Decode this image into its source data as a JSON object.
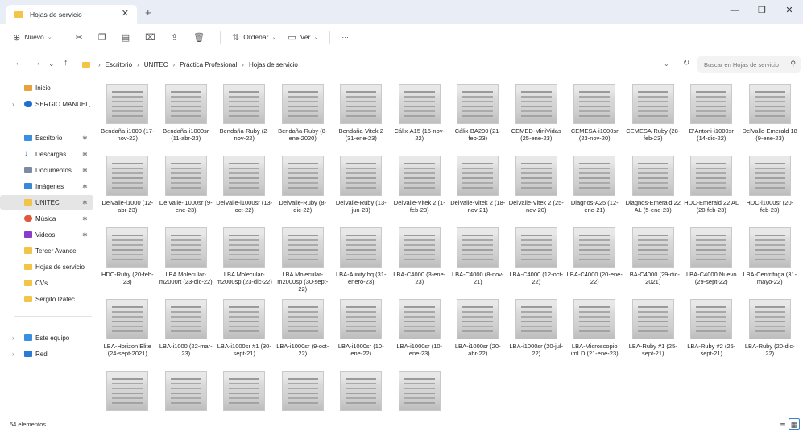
{
  "window": {
    "tab_title": "Hojas de servicio",
    "close_tab": "✕",
    "new_tab": "+",
    "minimize": "—",
    "maximize": "❐",
    "close": "✕"
  },
  "toolbar": {
    "new_label": "Nuevo",
    "sort_label": "Ordenar",
    "view_label": "Ver",
    "more_label": "···"
  },
  "address": {
    "crumbs": [
      "Escritorio",
      "UNITEC",
      "Práctica Profesional",
      "Hojas de servicio"
    ],
    "search_placeholder": "Buscar en Hojas de servicio"
  },
  "sidebar": {
    "items": [
      {
        "label": "Inicio",
        "color": "#e8a33c"
      },
      {
        "label": "SERGIO MANUEL, L",
        "color": "#1f6fd1"
      },
      {
        "label": "Escritorio",
        "color": "#3b8fe0"
      },
      {
        "label": "Descargas",
        "color": "#2a7bd6"
      },
      {
        "label": "Documentos",
        "color": "#7a8ba3"
      },
      {
        "label": "Imágenes",
        "color": "#3a88d8"
      },
      {
        "label": "UNITEC",
        "color": "#f2c44a"
      },
      {
        "label": "Música",
        "color": "#e0573c"
      },
      {
        "label": "Videos",
        "color": "#8a3cc9"
      },
      {
        "label": "Tercer Avance",
        "color": "#f2c44a"
      },
      {
        "label": "Hojas de servicio",
        "color": "#f2c44a"
      },
      {
        "label": "CVs",
        "color": "#f2c44a"
      },
      {
        "label": "Sergito Izatec",
        "color": "#f2c44a"
      },
      {
        "label": "Este equipo",
        "color": "#3b8fe0"
      },
      {
        "label": "Red",
        "color": "#2a7bd6"
      }
    ]
  },
  "files": [
    "Bendaña-i1000 (17-nov-22)",
    "Bendaña-i1000sr (11-abr-23)",
    "Bendaña-Ruby (2-nov-22)",
    "Bendaña-Ruby (8-ene-2020)",
    "Bendaña-Vitek 2 (31-ene-23)",
    "Cálix-A15 (16-nov-22)",
    "Cálix-BA200 (21-feb-23)",
    "CEMED-MiniVidas (25-ene-23)",
    "CEMESA-i1000sr (23-nov-20)",
    "CEMESA-Ruby (28-feb-23)",
    "D'Antoni-i1000sr (14-dic-22)",
    "DelValle-Emerald 18 (9-ene-23)",
    "DelValle-i1000 (12-abr-23)",
    "DelValle-i1000sr (9-ene-23)",
    "DelValle-i1000sr (13-oct-22)",
    "DelValle-Ruby (8-dic-22)",
    "DelValle-Ruby (13-jun-23)",
    "DelValle-Vitek 2 (1-feb-23)",
    "DelValle-Vitek 2 (18-nov-21)",
    "DelValle-Vitek 2 (25-nov-20)",
    "Diagnos-A25 (12-ene-21)",
    "Diagnos-Emerald 22 AL (5-ene-23)",
    "HDC-Emerald 22 AL (20-feb-23)",
    "HDC-i1000sr (20-feb-23)",
    "HDC-Ruby (20-feb-23)",
    "LBA Molecular-m2000rt (23-dic-22)",
    "LBA Molecular-m2000sp (23-dic-22)",
    "LBA Molecular-m2000sp (30-sept-22)",
    "LBA-Alinity hq (31-enero-23)",
    "LBA-C4000 (3-ene-23)",
    "LBA-C4000 (8-nov-21)",
    "LBA-C4000 (12-oct-22)",
    "LBA-C4000 (20-ene-22)",
    "LBA-C4000 (29-dic-2021)",
    "LBA-C4000 Nuevo (29-sept-22)",
    "LBA-Centrifuga (31-mayo-22)",
    "LBA-Horizon Elite (24-sept-2021)",
    "LBA-i1000 (22-mar-23)",
    "LBA-i1000sr #1 (30-sept-21)",
    "LBA-i1000sr (9-oct-22)",
    "LBA-i1000sr (10-ene-22)",
    "LBA-i1000sr (10-ene-23)",
    "LBA-i1000sr (20-abr-22)",
    "LBA-i1000sr (20-jul-22)",
    "LBA-Microscopio imLD (21-ene-23)",
    "LBA-Ruby #1 (25-sept-21)",
    "LBA-Ruby #2 (25-sept-21)",
    "LBA-Ruby (20-dic-22)",
    "",
    "",
    "",
    "",
    "",
    ""
  ],
  "status": {
    "count": "54 elementos"
  }
}
